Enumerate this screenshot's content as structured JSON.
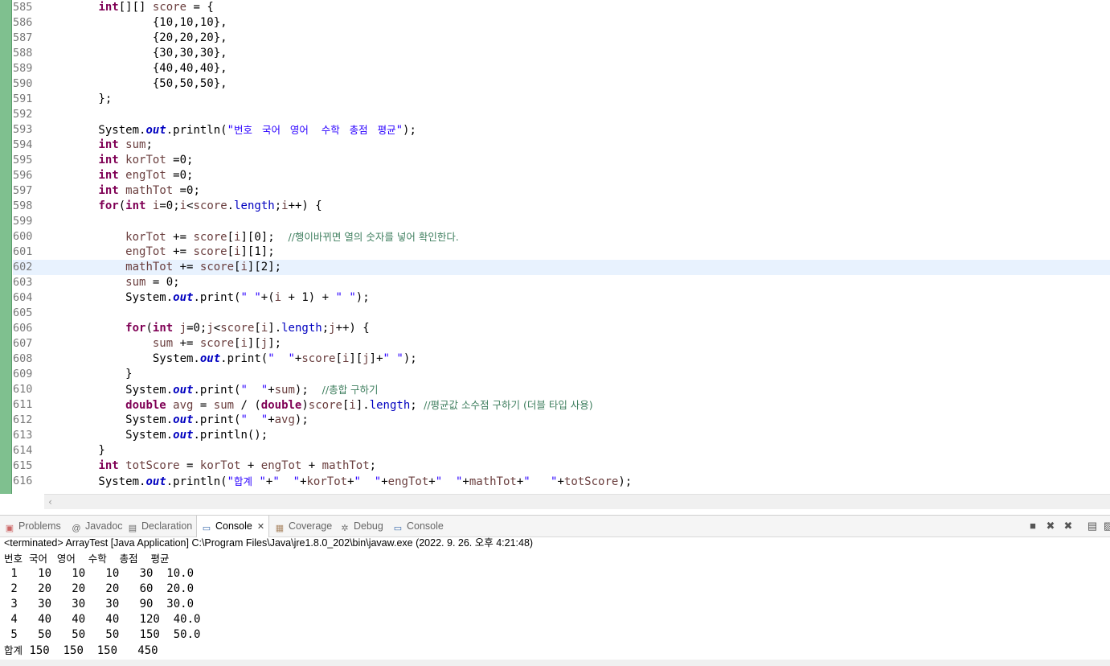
{
  "editor": {
    "current_line": "602",
    "lines": [
      {
        "n": "585",
        "html": "        <span class=\"kw\">int</span>[][] <span class=\"vr\">score</span> = {"
      },
      {
        "n": "586",
        "html": "                {10,10,10},"
      },
      {
        "n": "587",
        "html": "                {20,20,20},"
      },
      {
        "n": "588",
        "html": "                {30,30,30},"
      },
      {
        "n": "589",
        "html": "                {40,40,40},"
      },
      {
        "n": "590",
        "html": "                {50,50,50},"
      },
      {
        "n": "591",
        "html": "        };"
      },
      {
        "n": "592",
        "html": ""
      },
      {
        "n": "593",
        "html": "        System.<span class=\"fd\">out</span>.println(<span class=\"st\">\"<span class=\"str-ko\">번호   국어   영어    수학   총점   평균</span>\"</span>);"
      },
      {
        "n": "594",
        "html": "        <span class=\"kw\">int</span> <span class=\"vr\">sum</span>;"
      },
      {
        "n": "595",
        "html": "        <span class=\"kw\">int</span> <span class=\"vr\">korTot</span> =0;"
      },
      {
        "n": "596",
        "html": "        <span class=\"kw\">int</span> <span class=\"vr\">engTot</span> =0;"
      },
      {
        "n": "597",
        "html": "        <span class=\"kw\">int</span> <span class=\"vr\">mathTot</span> =0;"
      },
      {
        "n": "598",
        "html": "        <span class=\"kw\">for</span>(<span class=\"kw\">int</span> <span class=\"vr\">i</span>=0;<span class=\"vr\">i</span>&lt;<span class=\"vr\">score</span>.<span class=\"fl\">length</span>;<span class=\"vr\">i</span>++) {"
      },
      {
        "n": "599",
        "html": ""
      },
      {
        "n": "600",
        "html": "            <span class=\"vr\">korTot</span> += <span class=\"vr\">score</span>[<span class=\"vr\">i</span>][0];  <span class=\"cm\">//행이바뀌면 열의 숫자를 넣어 확인한다.</span>"
      },
      {
        "n": "601",
        "html": "            <span class=\"vr\">engTot</span> += <span class=\"vr\">score</span>[<span class=\"vr\">i</span>][1];"
      },
      {
        "n": "602",
        "html": "            <span class=\"vr\">mathTot</span> += <span class=\"vr\">score</span>[<span class=\"vr\">i</span>][2];"
      },
      {
        "n": "603",
        "html": "            <span class=\"vr\">sum</span> = 0;"
      },
      {
        "n": "604",
        "html": "            System.<span class=\"fd\">out</span>.print(<span class=\"st\">\" \"</span>+(<span class=\"vr\">i</span> + 1) + <span class=\"st\">\" \"</span>);"
      },
      {
        "n": "605",
        "html": ""
      },
      {
        "n": "606",
        "html": "            <span class=\"kw\">for</span>(<span class=\"kw\">int</span> <span class=\"vr\">j</span>=0;<span class=\"vr\">j</span>&lt;<span class=\"vr\">score</span>[<span class=\"vr\">i</span>].<span class=\"fl\">length</span>;<span class=\"vr\">j</span>++) {"
      },
      {
        "n": "607",
        "html": "                <span class=\"vr\">sum</span> += <span class=\"vr\">score</span>[<span class=\"vr\">i</span>][<span class=\"vr\">j</span>];"
      },
      {
        "n": "608",
        "html": "                System.<span class=\"fd\">out</span>.print(<span class=\"st\">\"  \"</span>+<span class=\"vr\">score</span>[<span class=\"vr\">i</span>][<span class=\"vr\">j</span>]+<span class=\"st\">\" \"</span>);"
      },
      {
        "n": "609",
        "html": "            }"
      },
      {
        "n": "610",
        "html": "            System.<span class=\"fd\">out</span>.print(<span class=\"st\">\"  \"</span>+<span class=\"vr\">sum</span>);  <span class=\"cm\">//총합 구하기</span>"
      },
      {
        "n": "611",
        "html": "            <span class=\"kw\">double</span> <span class=\"vr\">avg</span> = <span class=\"vr\">sum</span> / (<span class=\"kw\">double</span>)<span class=\"vr\">score</span>[<span class=\"vr\">i</span>].<span class=\"fl\">length</span>; <span class=\"cm\">//평균값 소수점 구하기 (더블 타입 사용)</span>"
      },
      {
        "n": "612",
        "html": "            System.<span class=\"fd\">out</span>.print(<span class=\"st\">\"  \"</span>+<span class=\"vr\">avg</span>);"
      },
      {
        "n": "613",
        "html": "            System.<span class=\"fd\">out</span>.println();"
      },
      {
        "n": "614",
        "html": "        }"
      },
      {
        "n": "615",
        "html": "        <span class=\"kw\">int</span> <span class=\"vr\">totScore</span> = <span class=\"vr\">korTot</span> + <span class=\"vr\">engTot</span> + <span class=\"vr\">mathTot</span>;"
      },
      {
        "n": "616",
        "html": "        System.<span class=\"fd\">out</span>.println(<span class=\"st\">\"<span class=\"str-ko\">합계</span> \"</span>+<span class=\"st\">\"  \"</span>+<span class=\"vr\">korTot</span>+<span class=\"st\">\"  \"</span>+<span class=\"vr\">engTot</span>+<span class=\"st\">\"  \"</span>+<span class=\"vr\">mathTot</span>+<span class=\"st\">\"   \"</span>+<span class=\"vr\">totScore</span>);"
      }
    ]
  },
  "tabs": {
    "problems": "Problems",
    "javadoc": "Javadoc",
    "declaration": "Declaration",
    "console": "Console",
    "coverage": "Coverage",
    "debug": "Debug",
    "console2": "Console"
  },
  "status": "<terminated> ArrayTest [Java Application] C:\\Program Files\\Java\\jre1.8.0_202\\bin\\javaw.exe (2022. 9. 26. 오후 4:21:48)",
  "console": {
    "header": "번호  국어   영어    수학    총점    평균",
    "rows": [
      " 1   10   10   10   30  10.0",
      " 2   20   20   20   60  20.0",
      " 3   30   30   30   90  30.0",
      " 4   40   40   40   120  40.0",
      " 5   50   50   50   150  50.0"
    ],
    "total": "합계 150  150  150   450"
  }
}
